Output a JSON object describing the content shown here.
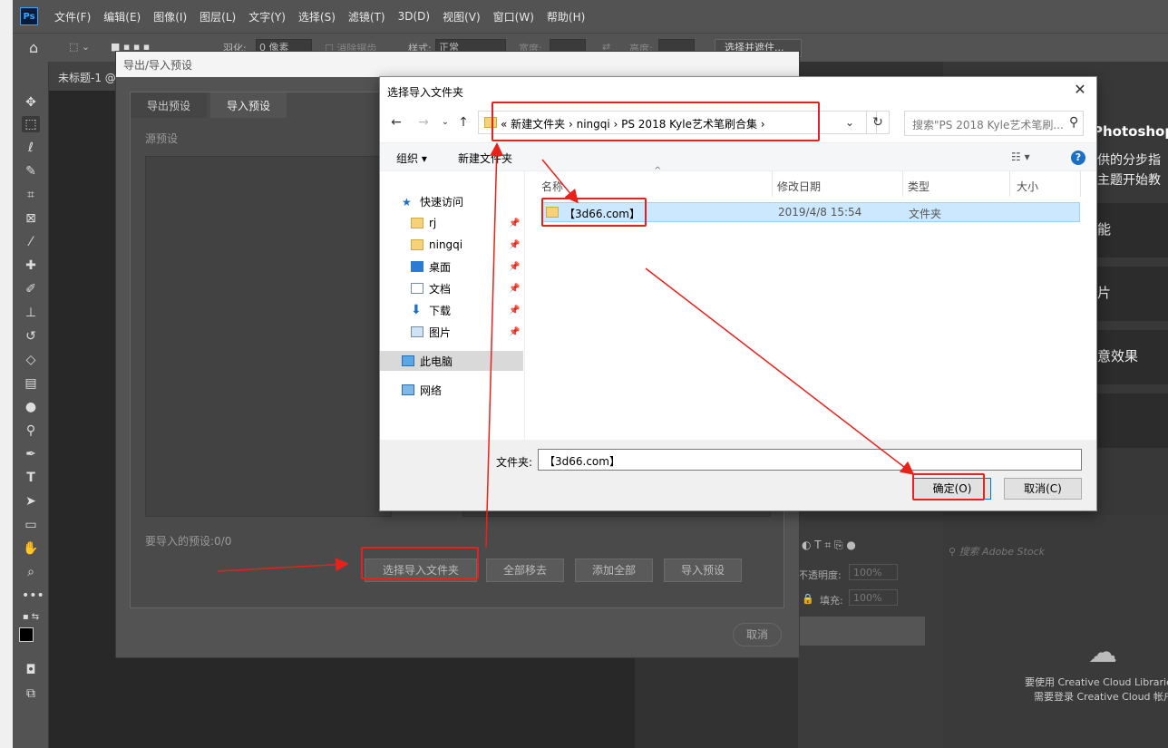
{
  "ps": {
    "logo": "Ps",
    "menu": [
      "文件(F)",
      "编辑(E)",
      "图像(I)",
      "图层(L)",
      "文字(Y)",
      "选择(S)",
      "滤镜(T)",
      "3D(D)",
      "视图(V)",
      "窗口(W)",
      "帮助(H)"
    ],
    "options": {
      "feather_label": "羽化:",
      "feather_value": "0 像素",
      "antialias_label": "消除锯齿",
      "style_label": "样式:",
      "style_value": "正常",
      "width_label": "宽度:",
      "height_label": "高度:",
      "select_mask_button": "选择并遮住..."
    },
    "doc_tab": "未标题-1 @",
    "learn": {
      "title": "Photoshop",
      "desc_line1": "供的分步指",
      "desc_line2": "主题开始教",
      "cards": [
        "能",
        "片",
        "意效果"
      ]
    },
    "layers": {
      "opacity_label": "不透明度:",
      "opacity_value": "100%",
      "fill_label": "填充:",
      "fill_value": "100%"
    },
    "libraries": {
      "search_placeholder": "搜索 Adobe Stock",
      "msg_line1": "要使用 Creative Cloud Librarie",
      "msg_line2": "需要登录 Creative Cloud 帐户"
    }
  },
  "export_import_dialog": {
    "title": "导出/导入预设",
    "tabs": [
      "导出预设",
      "导入预设"
    ],
    "source_label": "源预设",
    "count_text": "要导入的预设:0/0",
    "buttons": {
      "choose_folder": "选择导入文件夹",
      "remove_all": "全部移去",
      "add_all": "添加全部",
      "import_presets": "导入预设"
    },
    "cancel": "取消"
  },
  "folder_dialog": {
    "title": "选择导入文件夹",
    "breadcrumbs": "« 新建文件夹 › ningqi › PS 2018 Kyle艺术笔刷合集 ›",
    "search_placeholder": "搜索\"PS 2018 Kyle艺术笔刷...",
    "toolbar": {
      "organize": "组织 ▾",
      "new_folder": "新建文件夹"
    },
    "nav": {
      "quick_access": "快速访问",
      "items": [
        "rj",
        "ningqi",
        "桌面",
        "文档",
        "下载",
        "图片"
      ],
      "this_pc": "此电脑",
      "network": "网络"
    },
    "columns": [
      "名称",
      "修改日期",
      "类型",
      "大小"
    ],
    "rows": [
      {
        "name": "【3d66.com】",
        "date": "2019/4/8 15:54",
        "type": "文件夹"
      }
    ],
    "folder_label": "文件夹:",
    "folder_value": "【3d66.com】",
    "ok": "确定(O)",
    "cancel": "取消(C)"
  },
  "colors": {
    "annotation_red": "#e8211b",
    "selection_blue": "#cce8ff",
    "ps_dark": "#535353"
  }
}
